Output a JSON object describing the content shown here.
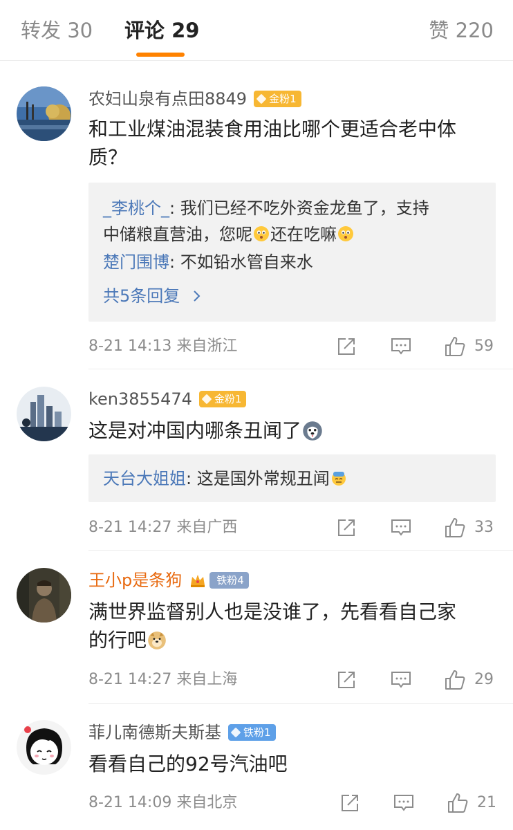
{
  "tabs": {
    "repost": "转发 30",
    "comments": "评论 29",
    "likes": "赞 220"
  },
  "comments": [
    {
      "username": "农妇山泉有点田8849",
      "badge": "金粉1",
      "text_line1": "和工业煤油混装食用油比哪个更适合老中体",
      "text_line2": "质？",
      "replies": [
        {
          "name": "_李桃个_",
          "text_a": ": 我们已经不吃外资金龙鱼了，支持",
          "text_b": "中储粮直营油，您呢",
          "text_c": "还在吃嘛"
        },
        {
          "name": "楚门围博",
          "text": ": 不如铅水管自来水"
        }
      ],
      "more_replies": "共5条回复",
      "time": "8-21 14:13  来自浙江",
      "likes": "59"
    },
    {
      "username": "ken3855474",
      "badge": "金粉1",
      "text": "这是对冲国内哪条丑闻了",
      "replies": [
        {
          "name": "天台大姐姐",
          "text": ": 这是国外常规丑闻"
        }
      ],
      "time": "8-21 14:27  来自广西",
      "likes": "33"
    },
    {
      "username": "王小p是条狗",
      "badge": "铁粉4",
      "text_line1": "满世界监督别人也是没谁了，先看看自己家",
      "text_line2": "的行吧",
      "time": "8-21 14:27  来自上海",
      "likes": "29"
    },
    {
      "username": "菲儿南德斯夫斯基",
      "badge": "铁粉1",
      "text": "看看自己的92号汽油吧",
      "time": "8-21 14:09  来自北京",
      "likes": "21"
    }
  ],
  "icons": {
    "share": "share-icon",
    "comment": "comment-icon",
    "like": "thumbs-up-icon"
  },
  "colors": {
    "accent": "#ff8200",
    "link": "#4b78b8",
    "gold_badge": "#f7b733",
    "iron_badge": "#5ea0e8"
  }
}
